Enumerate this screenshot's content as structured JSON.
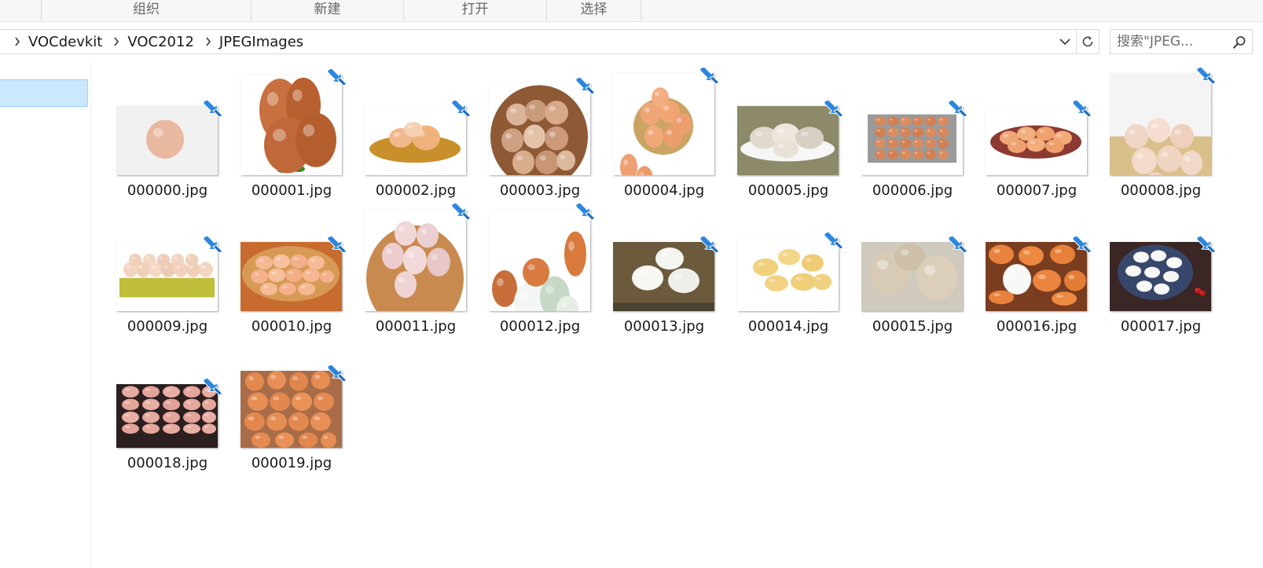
{
  "ribbon": {
    "groups": [
      "组织",
      "新建",
      "打开",
      "选择"
    ]
  },
  "address": {
    "breadcrumbs": [
      "VOCdevkit",
      "VOC2012",
      "JPEGImages"
    ]
  },
  "search": {
    "placeholder": "搜索\"JPEG..."
  },
  "icons": {
    "separator": "chevron-right-icon",
    "dropdown": "chevron-down-icon",
    "refresh": "refresh-icon",
    "search": "search-icon",
    "shortcut": "shortcut-arrow-icon"
  },
  "colors": {
    "selection": "#cce8ff",
    "selection_border": "#99d1ff",
    "shortcut_blue": "#1e7ad8"
  },
  "files": [
    {
      "name": "000000.jpg"
    },
    {
      "name": "000001.jpg"
    },
    {
      "name": "000002.jpg"
    },
    {
      "name": "000003.jpg"
    },
    {
      "name": "000004.jpg"
    },
    {
      "name": "000005.jpg"
    },
    {
      "name": "000006.jpg"
    },
    {
      "name": "000007.jpg"
    },
    {
      "name": "000008.jpg"
    },
    {
      "name": "000009.jpg"
    },
    {
      "name": "000010.jpg"
    },
    {
      "name": "000011.jpg"
    },
    {
      "name": "000012.jpg"
    },
    {
      "name": "000013.jpg"
    },
    {
      "name": "000014.jpg"
    },
    {
      "name": "000015.jpg"
    },
    {
      "name": "000016.jpg"
    },
    {
      "name": "000017.jpg"
    },
    {
      "name": "000018.jpg"
    },
    {
      "name": "000019.jpg"
    }
  ]
}
